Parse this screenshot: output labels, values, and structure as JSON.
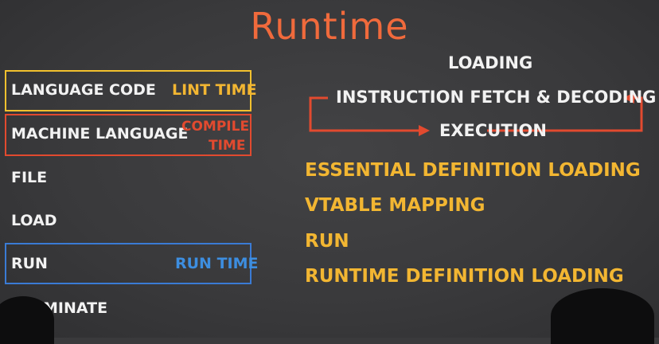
{
  "title": "Runtime",
  "left_list": {
    "language_code": "LANGUAGE CODE",
    "lint_time": "LINT TIME",
    "machine_language": "MACHINE LANGUAGE",
    "compile_time_1": "COMPILE",
    "compile_time_2": "TIME",
    "file": "FILE",
    "load": "LOAD",
    "run": "RUN",
    "run_time": "RUN TIME",
    "terminate": "MINATE"
  },
  "cycle": {
    "loading": "LOADING",
    "instruction": "INSTRUCTION FETCH & DECODING",
    "execution": "EXECUTION"
  },
  "steps": [
    "ESSENTIAL DEFINITION LOADING",
    "VTABLE MAPPING",
    "RUN",
    "RUNTIME DEFINITION LOADING"
  ],
  "colors": {
    "title": "#f06a3c",
    "lint": "#f2c12e",
    "compile": "#e24a2f",
    "run": "#3a7bd5",
    "steps": "#f2b632"
  }
}
